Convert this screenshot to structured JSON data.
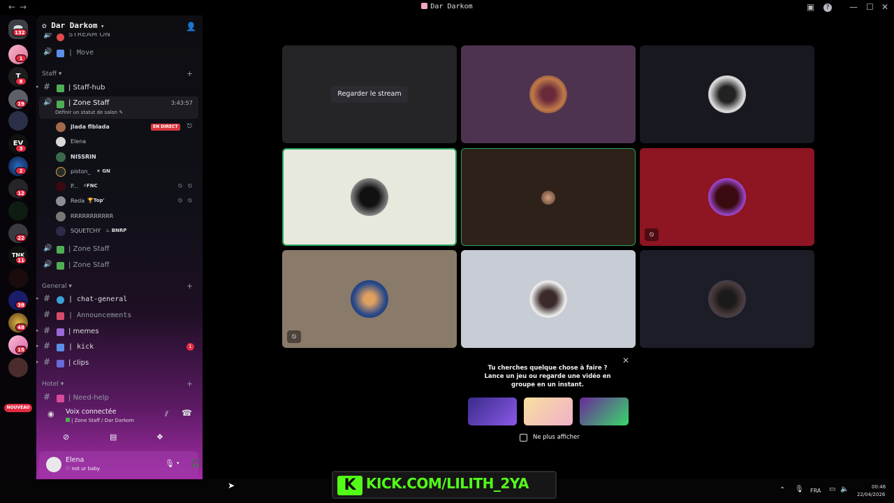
{
  "window": {
    "title": "Dar Darkom",
    "back_icon": "arrow-left-icon",
    "forward_icon": "arrow-right-icon"
  },
  "rail": {
    "dm_badge": "132",
    "badges": [
      "1",
      "8",
      "19",
      "3",
      "2",
      "12",
      "22",
      "11",
      "38",
      "48",
      "15"
    ],
    "new_label": "NOUVEAU"
  },
  "sidebar": {
    "server_name": "Dar Darkom",
    "top_items": [
      {
        "name": "STREAM ON"
      },
      {
        "name": "| Move"
      }
    ],
    "staff_category": "Staff",
    "staff_channels": [
      {
        "name": "| Staff-hub"
      }
    ],
    "zone_staff": {
      "name": "| Zone Staff",
      "timer": "3:43:57",
      "status_hint": "Définir un statut de salon"
    },
    "voice_users": [
      {
        "name": "jlada flblada",
        "live": "EN DIRECT"
      },
      {
        "name": "Elena"
      },
      {
        "name": "NISSRIN"
      },
      {
        "name": "piston_",
        "tag": "GN"
      },
      {
        "name": "P...",
        "tag": "FNC"
      },
      {
        "name": "Reda",
        "tag": "Top'"
      },
      {
        "name": "RRRRRRRRRRR"
      },
      {
        "name": "SQUETCHY",
        "tag": "BNRP"
      }
    ],
    "other_zones": [
      "| Zone Staff",
      "| Zone Staff"
    ],
    "general_category": "General",
    "general_channels": [
      {
        "name": "| chat-general"
      },
      {
        "name": "| Announcements"
      },
      {
        "name": "| memes"
      },
      {
        "name": "| kick",
        "badge": "1"
      },
      {
        "name": "| clips"
      }
    ],
    "hotel_category": "Hotel",
    "hotel_channels": [
      {
        "name": "| Need-help"
      }
    ],
    "voice_status": {
      "title": "Voix connectée",
      "subtitle": "| Zone Staff / Dar Darkom"
    },
    "user": {
      "name": "Elena",
      "status": "not ur baby"
    }
  },
  "stage": {
    "watch_stream_label": "Regarder le stream",
    "tiles": [
      {
        "bg": "#252528"
      },
      {
        "bg": "#4e3350"
      },
      {
        "bg": "#181820"
      },
      {
        "bg": "#e8e9dd"
      },
      {
        "bg": "#2d211a"
      },
      {
        "bg": "#8e1522"
      },
      {
        "bg": "#8a7a6a"
      },
      {
        "bg": "#c8ccd4"
      },
      {
        "bg": "#1c1d26"
      }
    ],
    "activity": {
      "line1": "Tu cherches quelque chose à faire ?",
      "line2": "Lance un jeu ou regarde une vidéo en groupe en un instant.",
      "checkbox_label": "Ne plus afficher"
    }
  },
  "overlay": {
    "kick_text": "KICK.COM/LILITH_2YA"
  },
  "taskbar": {
    "lang": "FRA",
    "time": "00:46",
    "date": "22/04/2026"
  }
}
